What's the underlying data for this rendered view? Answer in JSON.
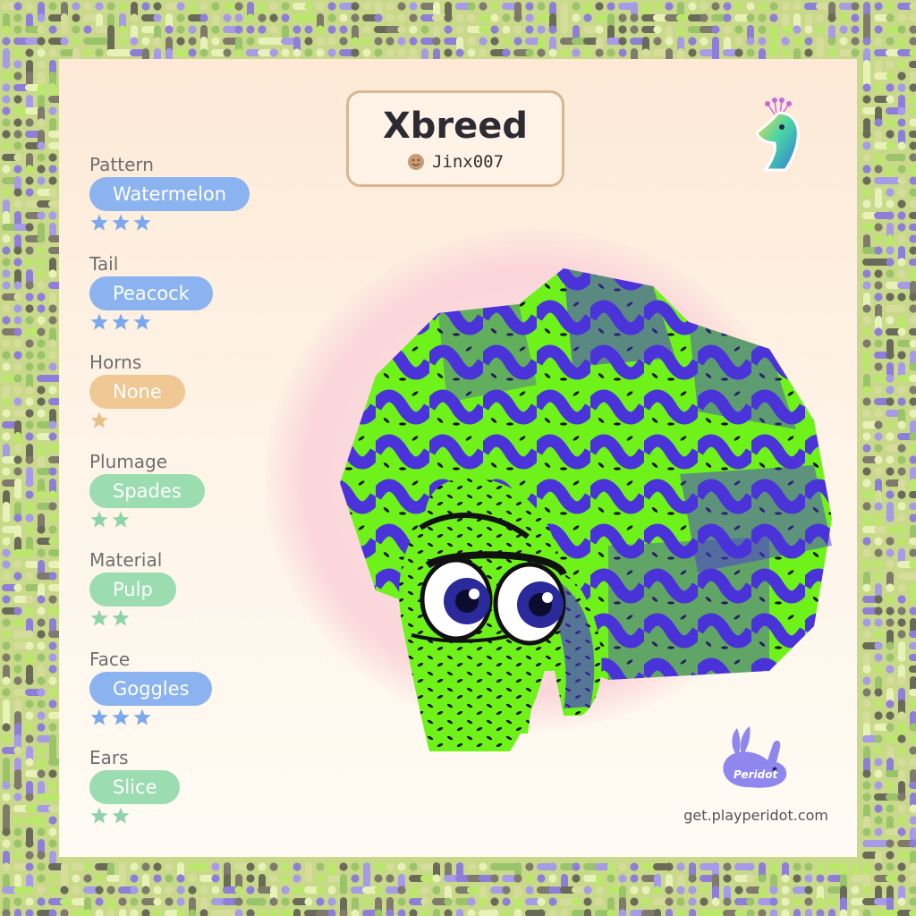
{
  "card": {
    "creature_name": "Xbreed",
    "owner_name": "Jinx007",
    "site_url": "get.playperidot.com",
    "logo_text": "Peridot"
  },
  "traits": [
    {
      "label": "Pattern",
      "value": "Watermelon",
      "stars": 3,
      "color": "#8ab3ef",
      "star_color": "#7ba8ee"
    },
    {
      "label": "Tail",
      "value": "Peacock",
      "stars": 3,
      "color": "#8ab3ef",
      "star_color": "#7ba8ee"
    },
    {
      "label": "Horns",
      "value": "None",
      "stars": 1,
      "color": "#efc894",
      "star_color": "#e9bf88"
    },
    {
      "label": "Plumage",
      "value": "Spades",
      "stars": 2,
      "color": "#9bdcb1",
      "star_color": "#8fd4a8"
    },
    {
      "label": "Material",
      "value": "Pulp",
      "stars": 2,
      "color": "#9bdcb1",
      "star_color": "#8fd4a8"
    },
    {
      "label": "Face",
      "value": "Goggles",
      "stars": 3,
      "color": "#8ab3ef",
      "star_color": "#7ba8ee"
    },
    {
      "label": "Ears",
      "value": "Slice",
      "stars": 2,
      "color": "#9bdcb1",
      "star_color": "#8fd4a8"
    }
  ],
  "colors": {
    "creature_green": "#6ef21a",
    "creature_purple": "#4a33d9",
    "border_palette": [
      "#8f7ed8",
      "#b9e86b",
      "#7f7a6b",
      "#d6dc9a",
      "#9ac46a",
      "#a79ae6",
      "#e8f2b8",
      "#6a6a58"
    ]
  },
  "icons": {
    "owner": "smiley-face-icon",
    "corner_logo": "peridot-bird-icon",
    "bunny_logo": "peridot-bunny-icon",
    "star": "star-icon"
  }
}
